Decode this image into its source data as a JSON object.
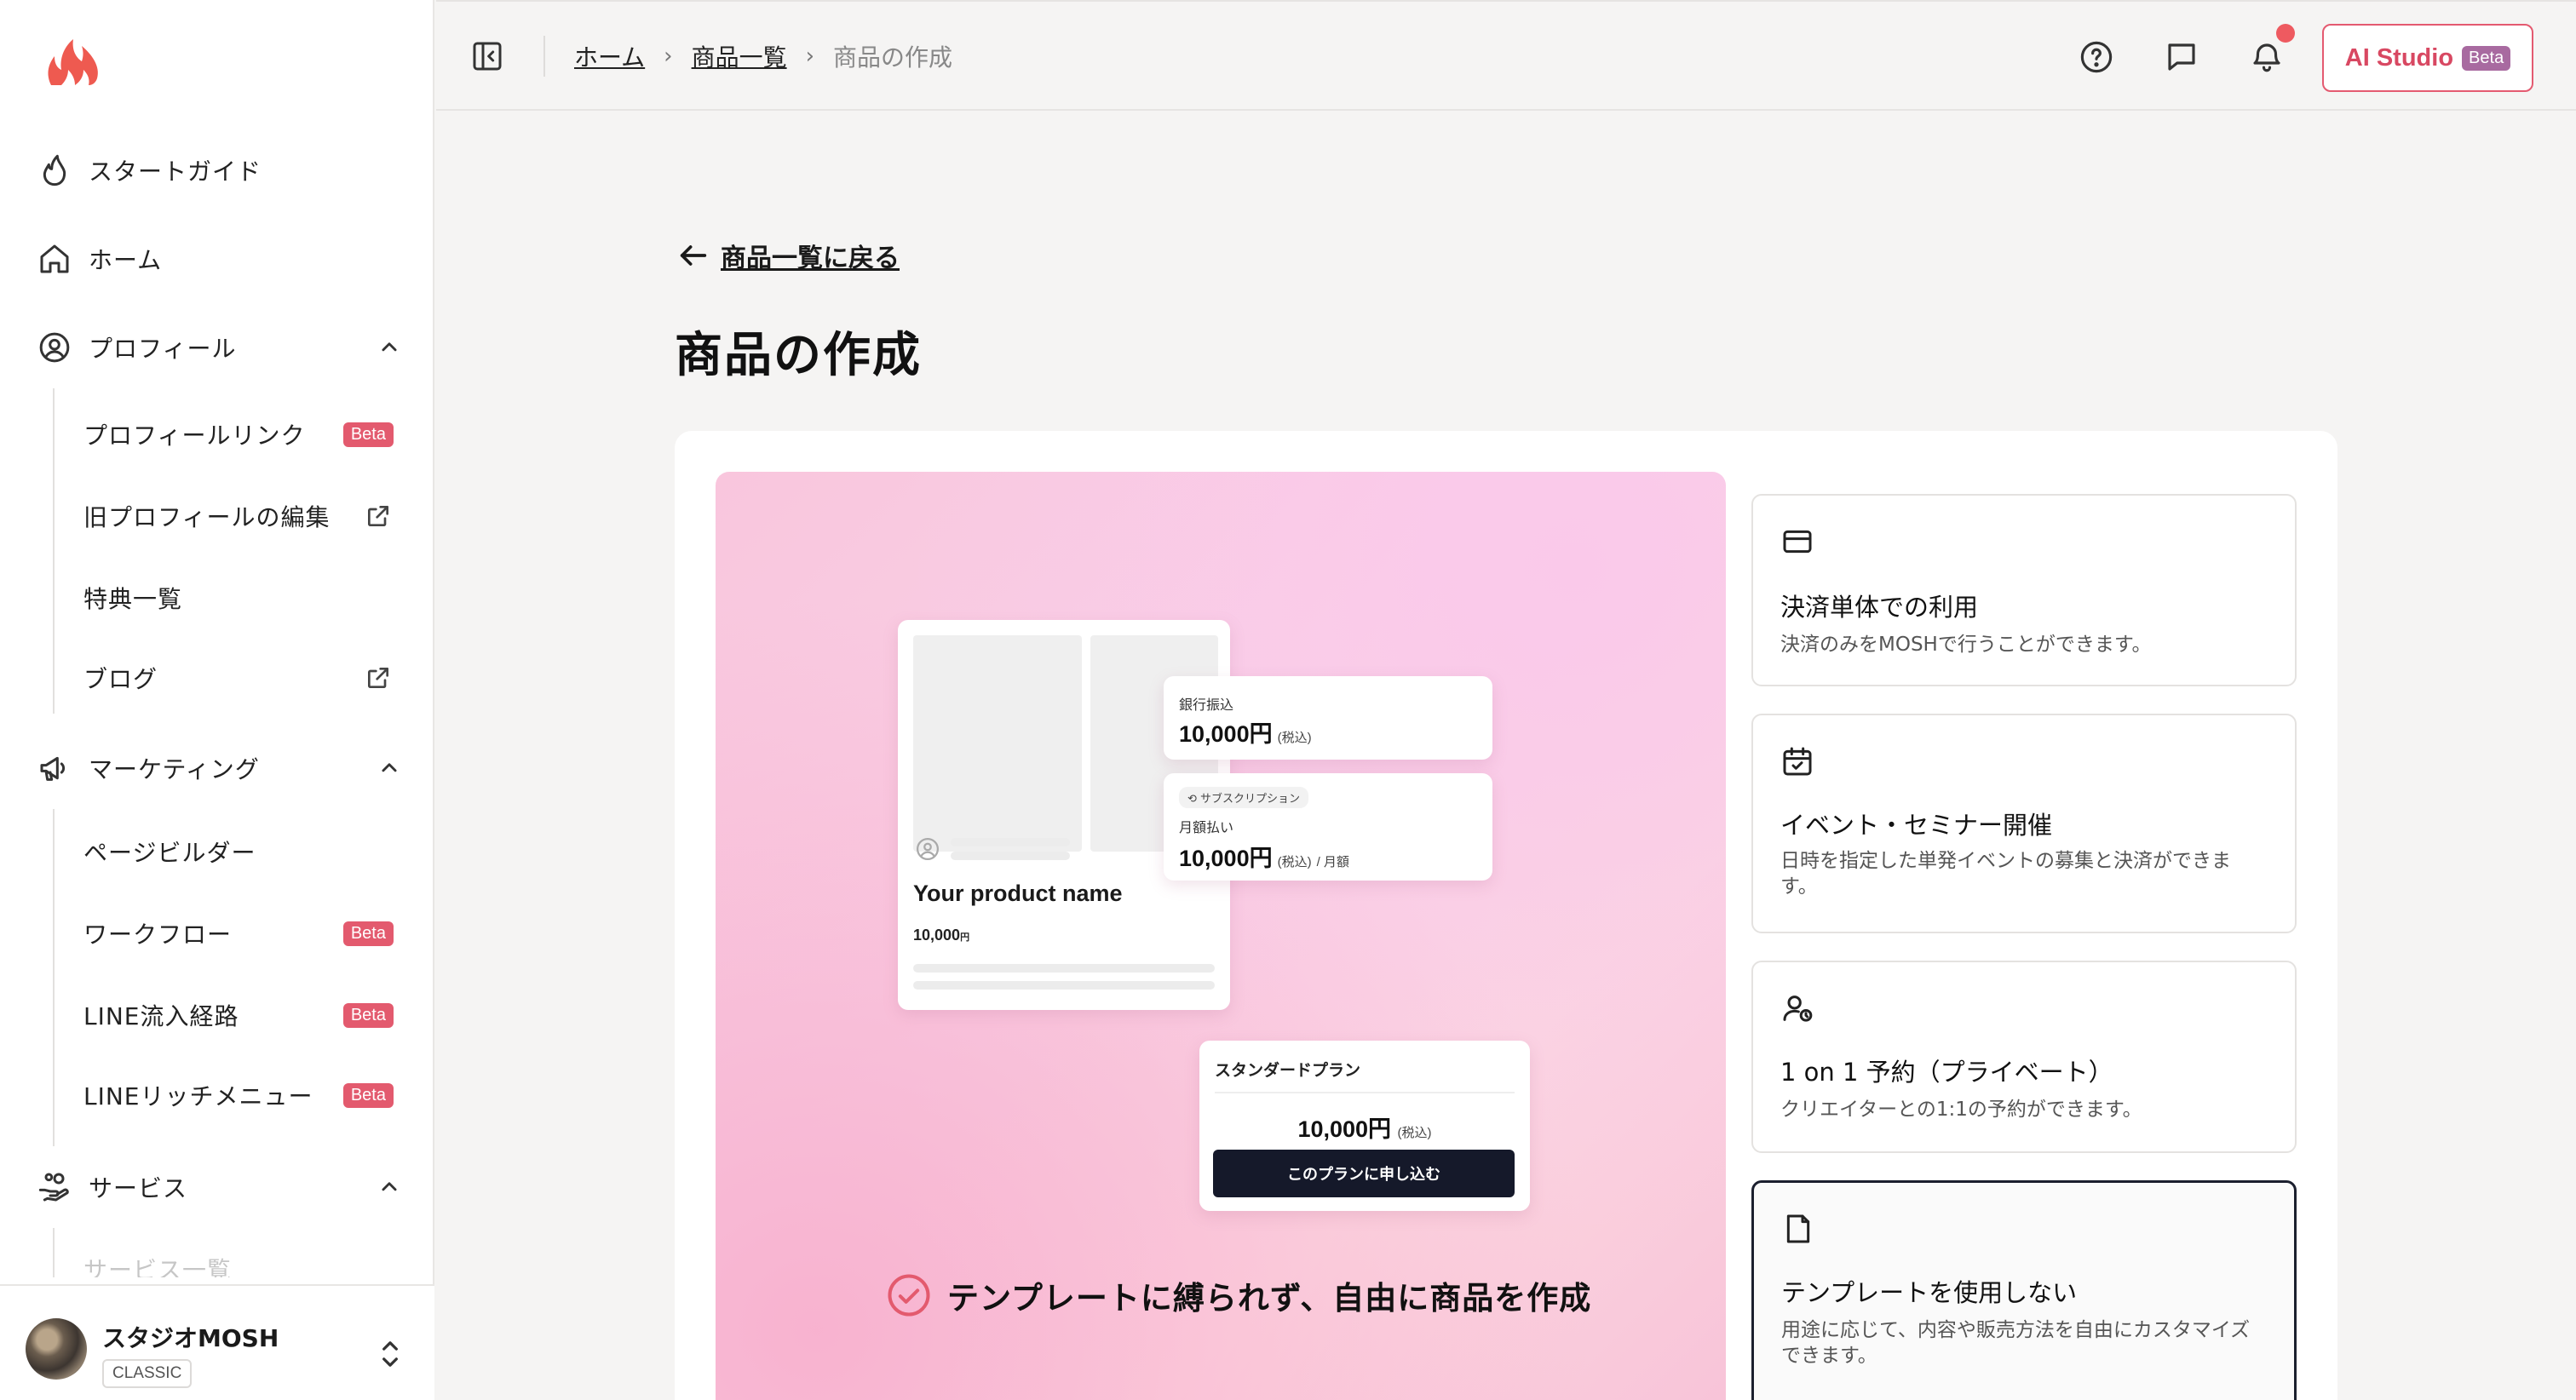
{
  "sidebar": {
    "items": [
      {
        "label": "スタートガイド",
        "icon": "flame-icon"
      },
      {
        "label": "ホーム",
        "icon": "home-icon"
      },
      {
        "label": "プロフィール",
        "icon": "user-circle-icon"
      },
      {
        "label": "マーケティング",
        "icon": "megaphone-icon"
      },
      {
        "label": "サービス",
        "icon": "hand-coins-icon"
      }
    ],
    "profile_sub": [
      {
        "label": "プロフィールリンク",
        "badge": "Beta"
      },
      {
        "label": "旧プロフィールの編集"
      },
      {
        "label": "特典一覧"
      },
      {
        "label": "ブログ"
      }
    ],
    "marketing_sub": [
      {
        "label": "ページビルダー"
      },
      {
        "label": "ワークフロー",
        "badge": "Beta"
      },
      {
        "label": "LINE流入経路",
        "badge": "Beta"
      },
      {
        "label": "LINEリッチメニュー",
        "badge": "Beta"
      }
    ],
    "service_sub": [
      {
        "label": "サービス一覧"
      }
    ],
    "account": {
      "name": "スタジオMOSH",
      "plan": "CLASSIC"
    }
  },
  "header": {
    "breadcrumbs": [
      "ホーム",
      "商品一覧",
      "商品の作成"
    ],
    "ai_studio_label": "AI Studio",
    "ai_studio_badge": "Beta",
    "has_notification": true
  },
  "main": {
    "back_label": "商品一覧に戻る",
    "title": "商品の作成",
    "preview": {
      "product_name": "Your  product name",
      "product_price": "10,000",
      "product_price_unit": "円",
      "bank": {
        "label": "銀行振込",
        "price": "10,000円",
        "tax": "(税込)"
      },
      "subscription": {
        "tag": "サブスクリプション",
        "label": "月額払い",
        "price": "10,000円",
        "tax": "(税込)",
        "period": "/ 月額"
      },
      "plan": {
        "title": "スタンダードプラン",
        "price": "10,000円",
        "tax": "(税込)",
        "button": "このプランに申し込む"
      },
      "tagline": "テンプレートに縛られず、自由に商品を作成"
    },
    "options": [
      {
        "title": "決済単体での利用",
        "desc": "決済のみをMOSHで行うことができます。",
        "icon": "credit-card-icon",
        "selected": false
      },
      {
        "title": "イベント・セミナー開催",
        "desc": "日時を指定した単発イベントの募集と決済ができます。",
        "icon": "calendar-check-icon",
        "selected": false
      },
      {
        "title": "1 on 1 予約（プライベート）",
        "desc": "クリエイターとの1:1の予約ができます。",
        "icon": "user-clock-icon",
        "selected": false
      },
      {
        "title": "テンプレートを使用しない",
        "desc": "用途に応じて、内容や販売方法を自由にカスタマイズできます。",
        "icon": "file-icon",
        "selected": true
      }
    ]
  },
  "colors": {
    "accent": "#e35a6e",
    "primary_dark": "#15192a",
    "badge_beta": "#e35a6e",
    "notif_dot": "#ee5a60"
  }
}
